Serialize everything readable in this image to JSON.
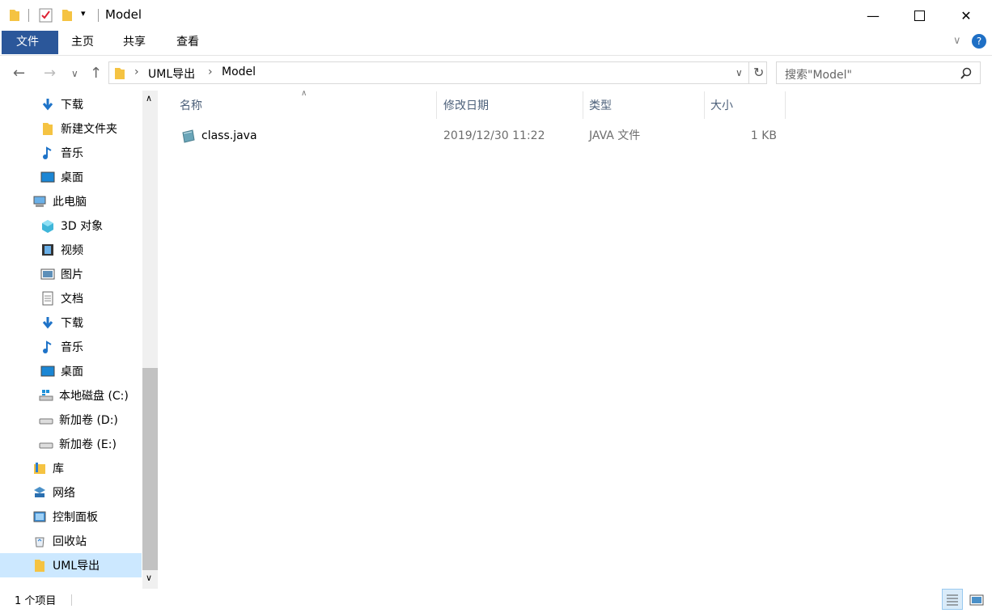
{
  "window": {
    "title": "Model"
  },
  "ribbon": {
    "tabs": [
      "文件",
      "主页",
      "共享",
      "查看"
    ]
  },
  "address": {
    "segments": [
      "UML导出",
      "Model"
    ]
  },
  "search": {
    "placeholder": "搜索\"Model\""
  },
  "nav_pane": {
    "items": [
      {
        "label": "下载",
        "icon": "download-icon"
      },
      {
        "label": "新建文件夹",
        "icon": "folder-icon"
      },
      {
        "label": "音乐",
        "icon": "music-icon"
      },
      {
        "label": "桌面",
        "icon": "desktop-icon"
      },
      {
        "label": "此电脑",
        "icon": "computer-icon"
      },
      {
        "label": "3D 对象",
        "icon": "cube-icon"
      },
      {
        "label": "视频",
        "icon": "video-icon"
      },
      {
        "label": "图片",
        "icon": "picture-icon"
      },
      {
        "label": "文档",
        "icon": "document-icon"
      },
      {
        "label": "下载",
        "icon": "download-icon"
      },
      {
        "label": "音乐",
        "icon": "music-icon"
      },
      {
        "label": "桌面",
        "icon": "desktop-icon"
      },
      {
        "label": "本地磁盘 (C:)",
        "icon": "drive-c-icon"
      },
      {
        "label": "新加卷 (D:)",
        "icon": "drive-icon"
      },
      {
        "label": "新加卷 (E:)",
        "icon": "drive-icon"
      },
      {
        "label": "库",
        "icon": "library-icon"
      },
      {
        "label": "网络",
        "icon": "network-icon"
      },
      {
        "label": "控制面板",
        "icon": "control-panel-icon"
      },
      {
        "label": "回收站",
        "icon": "recycle-bin-icon"
      },
      {
        "label": "UML导出",
        "icon": "folder-icon"
      }
    ]
  },
  "file_list": {
    "columns": [
      "名称",
      "修改日期",
      "类型",
      "大小"
    ],
    "rows": [
      {
        "name": "class.java",
        "modified": "2019/12/30 11:22",
        "type": "JAVA 文件",
        "size": "1 KB"
      }
    ]
  },
  "status_bar": {
    "item_count": "1 个项目"
  },
  "colors": {
    "file_tab": "#2b579a",
    "selection": "#cce8ff",
    "folder": "#f5c342"
  }
}
